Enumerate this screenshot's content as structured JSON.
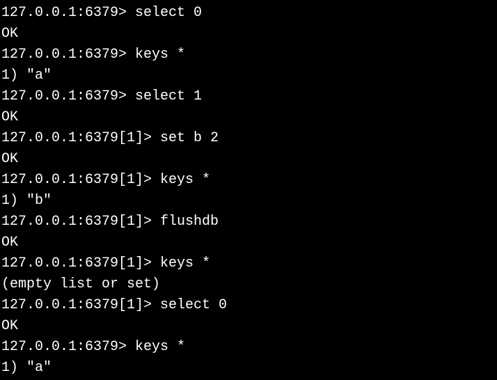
{
  "terminal": {
    "lines": [
      {
        "prompt": "127.0.0.1:6379> ",
        "command": "select 0"
      },
      {
        "output": "OK"
      },
      {
        "prompt": "127.0.0.1:6379> ",
        "command": "keys *"
      },
      {
        "output": "1) \"a\""
      },
      {
        "prompt": "127.0.0.1:6379> ",
        "command": "select 1"
      },
      {
        "output": "OK"
      },
      {
        "prompt": "127.0.0.1:6379[1]> ",
        "command": "set b 2"
      },
      {
        "output": "OK"
      },
      {
        "prompt": "127.0.0.1:6379[1]> ",
        "command": "keys *"
      },
      {
        "output": "1) \"b\""
      },
      {
        "prompt": "127.0.0.1:6379[1]> ",
        "command": "flushdb"
      },
      {
        "output": "OK"
      },
      {
        "prompt": "127.0.0.1:6379[1]> ",
        "command": "keys *"
      },
      {
        "output": "(empty list or set)"
      },
      {
        "prompt": "127.0.0.1:6379[1]> ",
        "command": "select 0"
      },
      {
        "output": "OK"
      },
      {
        "prompt": "127.0.0.1:6379> ",
        "command": "keys *"
      },
      {
        "output": "1) \"a\""
      }
    ]
  }
}
